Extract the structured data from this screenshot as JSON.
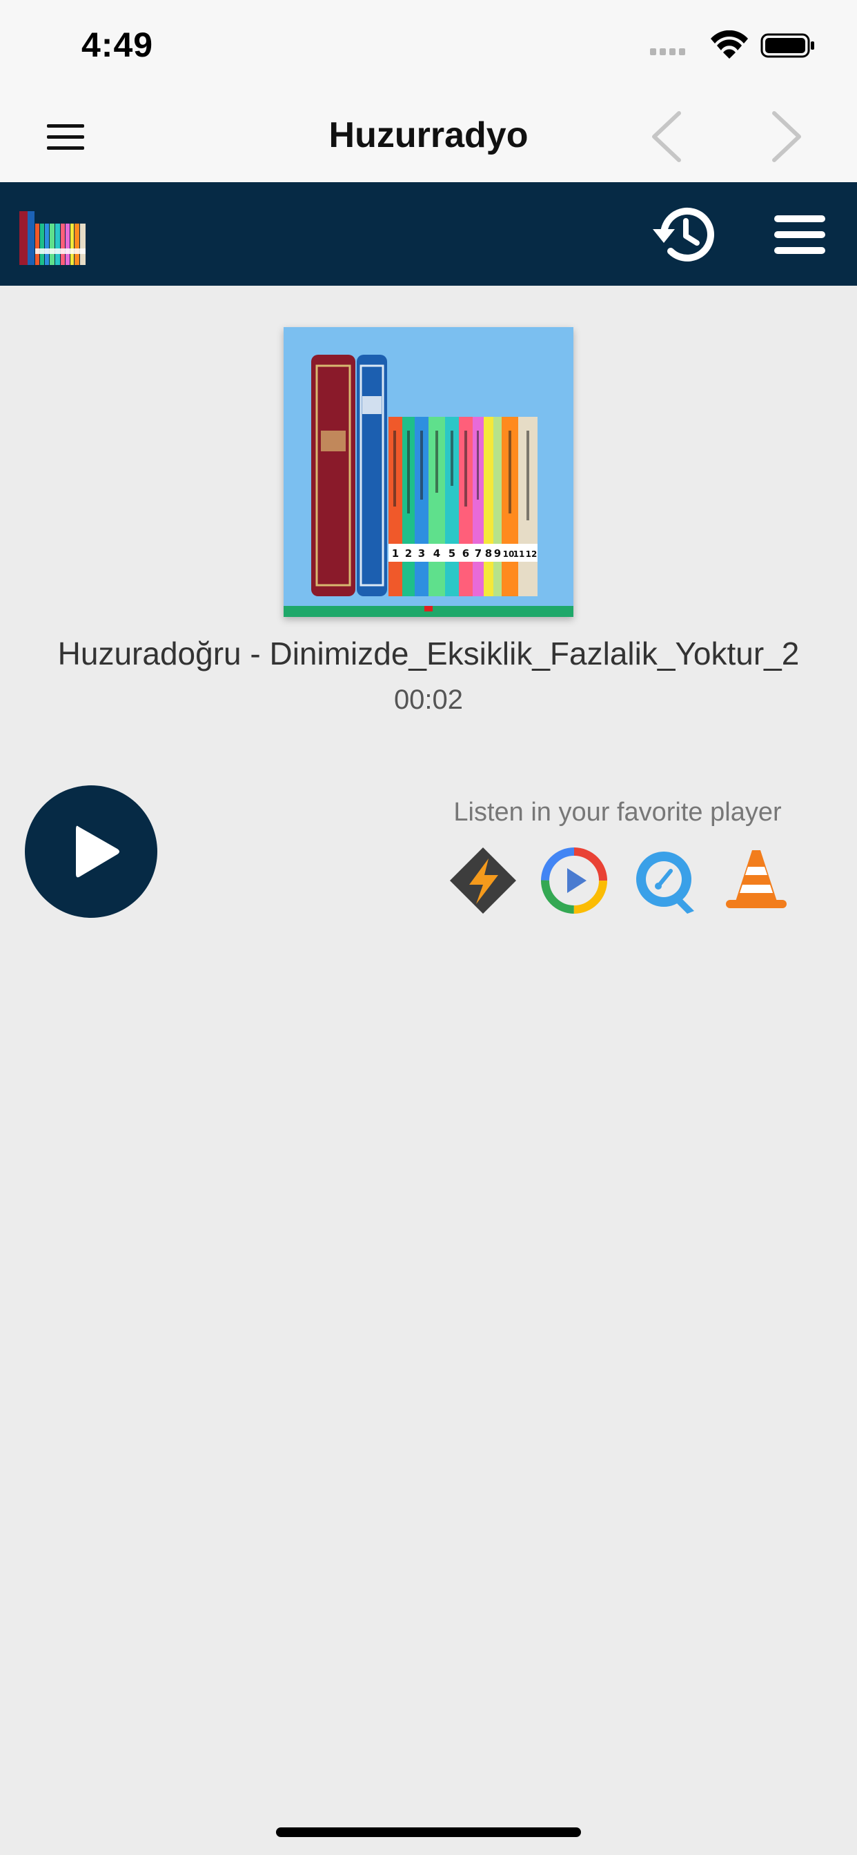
{
  "status_bar": {
    "time": "4:49"
  },
  "nav_bar": {
    "title": "Huzurradyo"
  },
  "player": {
    "track_title": "Huzuradoğru - Dinimizde_Eksiklik_Fazlalik_Yoktur_2",
    "elapsed": "00:02",
    "listen_label": "Listen in your favorite player",
    "external_players": [
      "winamp-icon",
      "google-play-music-icon",
      "quicktime-icon",
      "vlc-icon"
    ]
  },
  "cover": {
    "book_numbers": [
      "1",
      "2",
      "3",
      "4",
      "5",
      "6",
      "7",
      "8",
      "9",
      "10",
      "11",
      "12"
    ]
  },
  "colors": {
    "header_bg": "#062a45",
    "page_bg": "#ececec",
    "bar_bg": "#f7f7f7",
    "cover_bg": "#7bbff0"
  }
}
